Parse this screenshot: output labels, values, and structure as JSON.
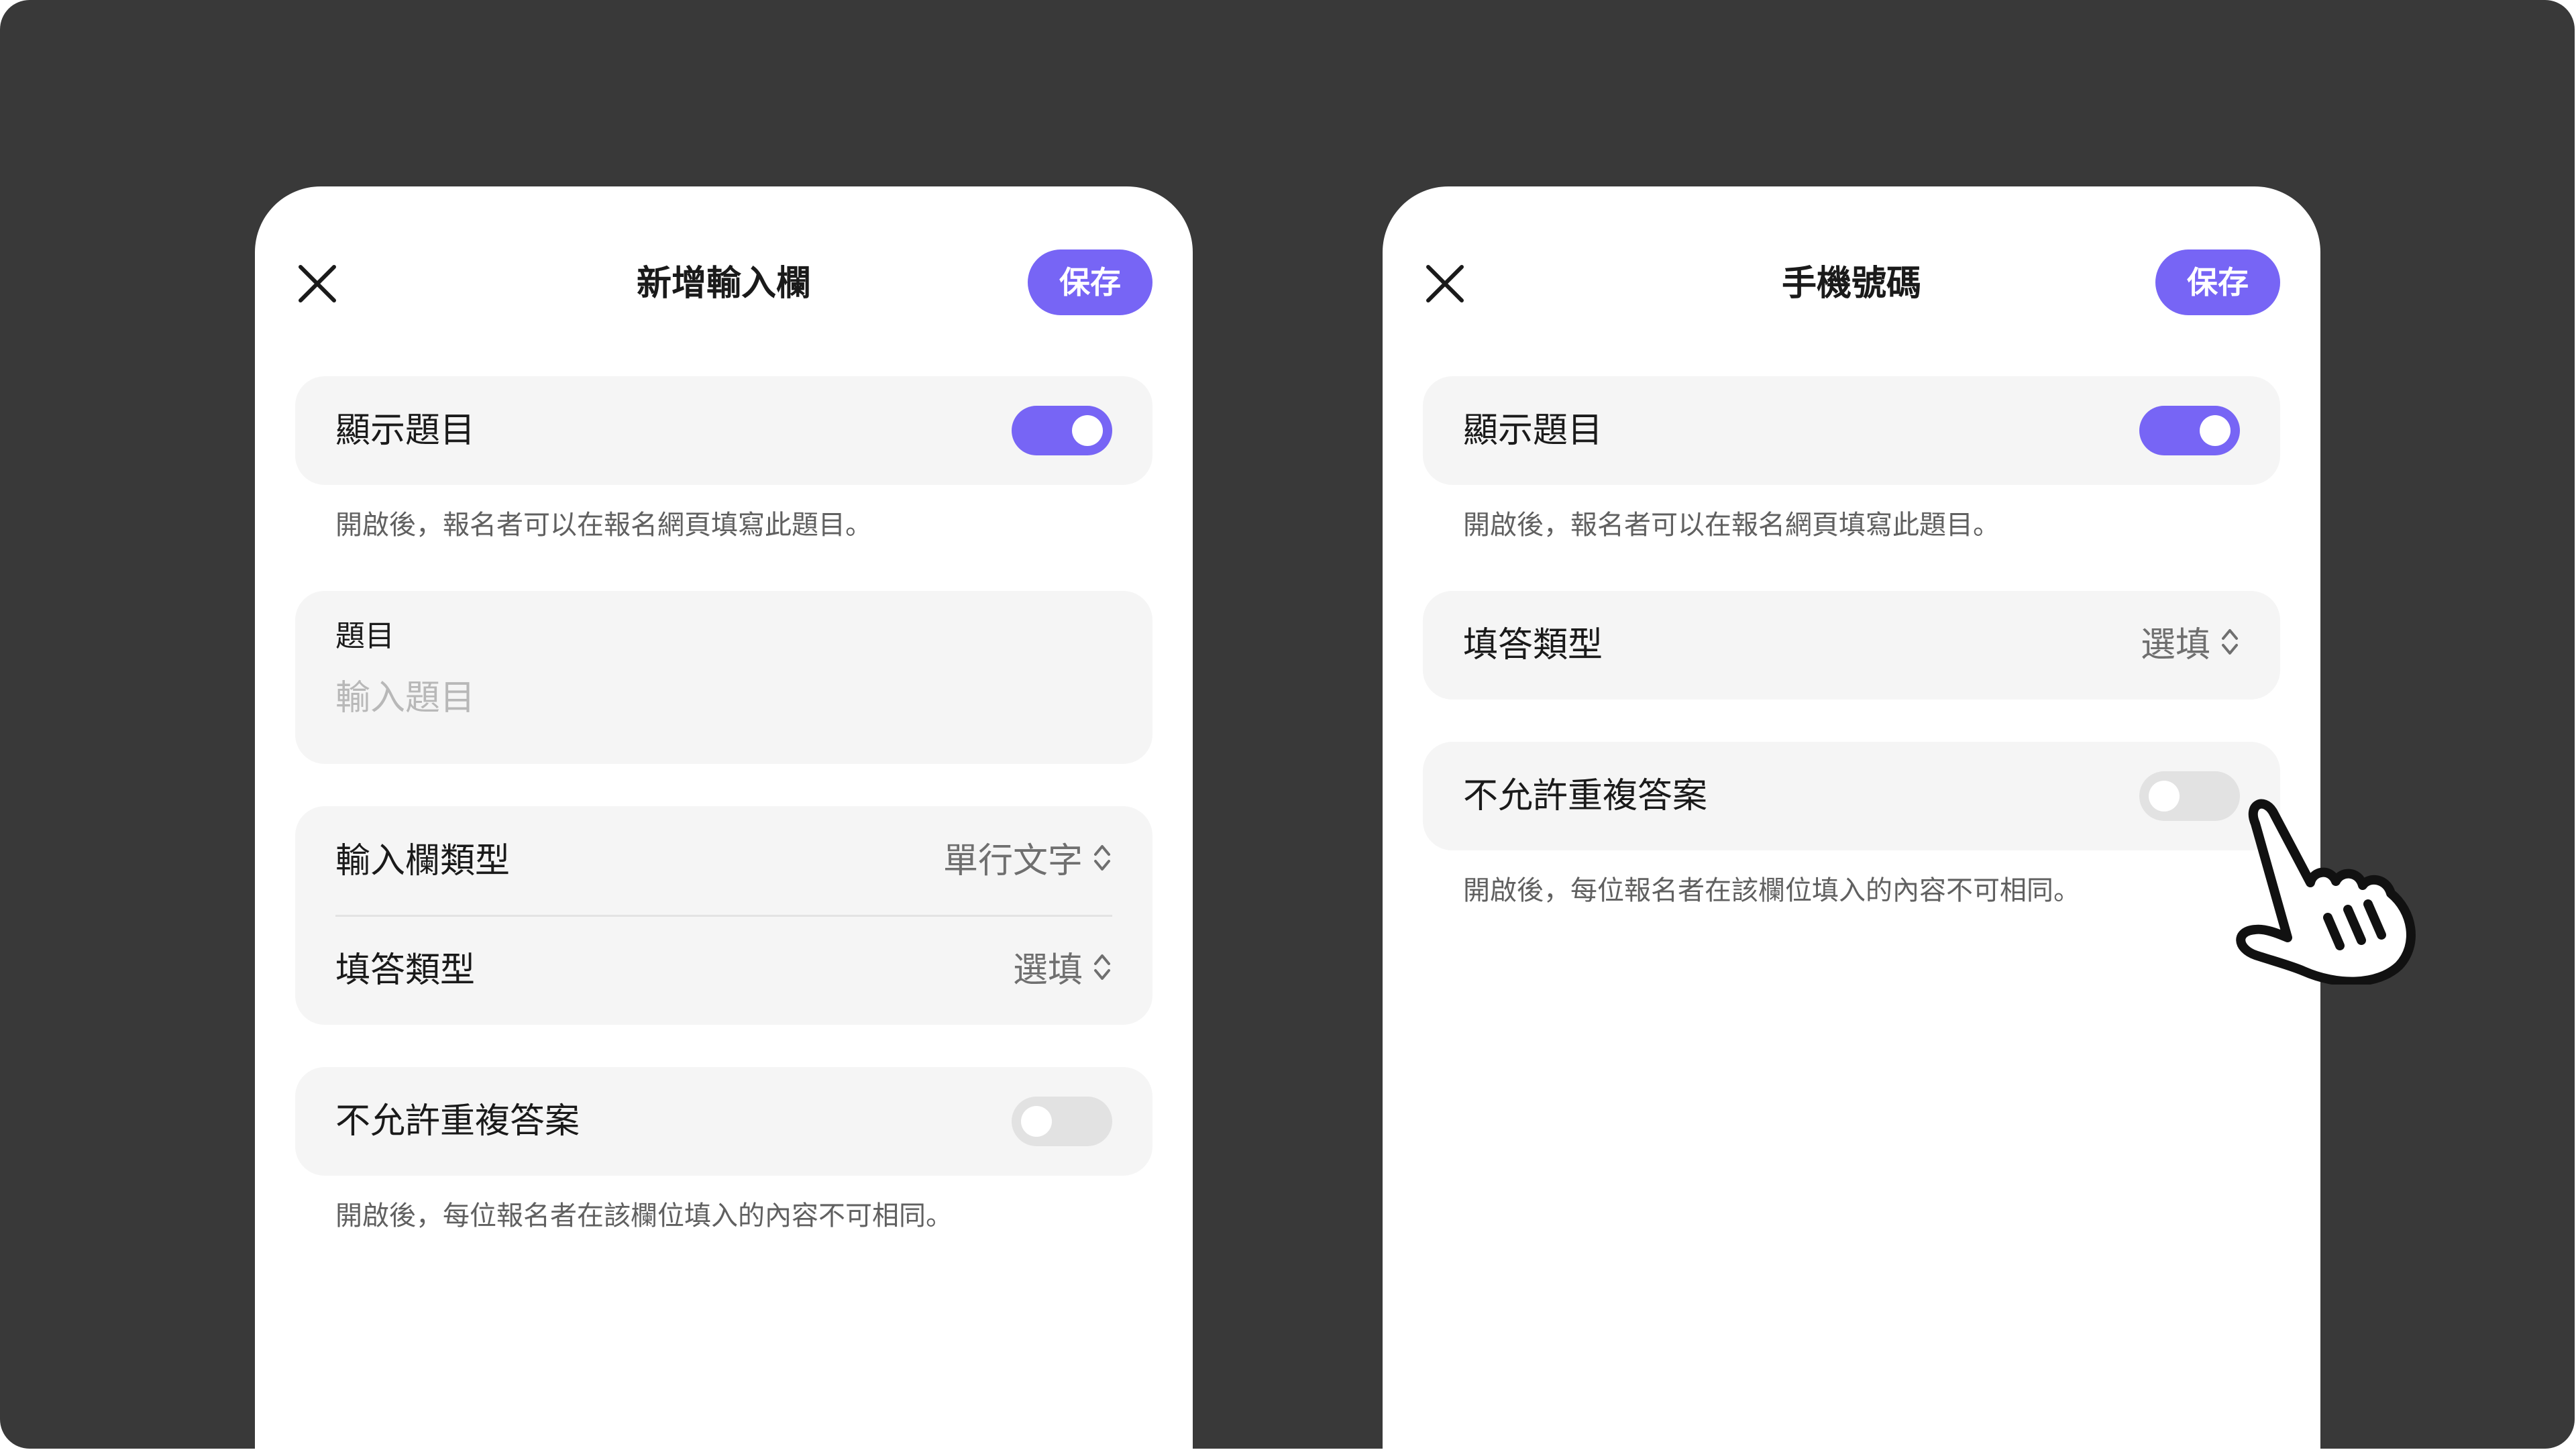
{
  "left_panel": {
    "title": "新增輸入欄",
    "save_label": "保存",
    "show_question": {
      "label": "顯示題目",
      "enabled": true
    },
    "show_question_help": "開啟後，報名者可以在報名網頁填寫此題目。",
    "question_field": {
      "label": "題目",
      "placeholder": "輸入題目",
      "value": ""
    },
    "input_type": {
      "label": "輸入欄類型",
      "value": "單行文字"
    },
    "answer_type": {
      "label": "填答類型",
      "value": "選填"
    },
    "no_duplicate": {
      "label": "不允許重複答案",
      "enabled": false
    },
    "no_duplicate_help": "開啟後，每位報名者在該欄位填入的內容不可相同。"
  },
  "right_panel": {
    "title": "手機號碼",
    "save_label": "保存",
    "show_question": {
      "label": "顯示題目",
      "enabled": true
    },
    "show_question_help": "開啟後，報名者可以在報名網頁填寫此題目。",
    "answer_type": {
      "label": "填答類型",
      "value": "選填"
    },
    "no_duplicate": {
      "label": "不允許重複答案",
      "enabled": false
    },
    "no_duplicate_help": "開啟後，每位報名者在該欄位填入的內容不可相同。"
  },
  "icons": {
    "close": "close-icon",
    "updown": "chevron-up-down-icon",
    "pointer": "hand-pointer-icon"
  },
  "colors": {
    "accent": "#7765f5",
    "backdrop": "#393939",
    "card": "#f5f5f5",
    "toggle_off": "#e2e2e2",
    "helper_text": "#606060"
  }
}
